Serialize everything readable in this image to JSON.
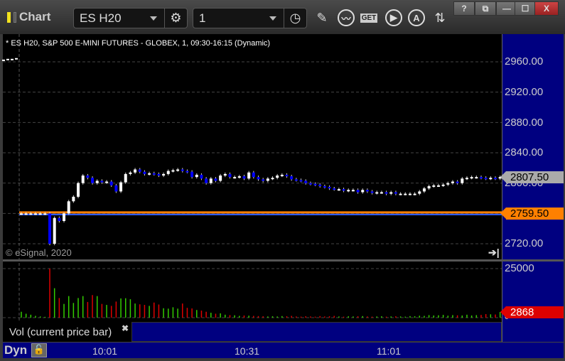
{
  "window": {
    "title": "Chart",
    "help": "?",
    "minimize": "—",
    "maximize": "☐",
    "close": "X"
  },
  "toolbar": {
    "symbol": "ES H20",
    "interval": "1",
    "get_label": "GET",
    "draw_icon": "pencil-icon",
    "study_icon": "study-icon",
    "play_icon": "play-icon",
    "alert_icon": "alert-icon",
    "link_icon": "link-icon"
  },
  "chart": {
    "header": "* ES H20, S&P 500 E-MINI FUTURES - GLOBEX, 1, 09:30-16:15 (Dynamic)",
    "copyright": "© eSignal, 2020",
    "price_labels": [
      "2960.00",
      "2920.00",
      "2880.00",
      "2840.00",
      "2800.00",
      "2720.00"
    ],
    "last_price": "2807.50",
    "line_price": "2759.50",
    "vol_labels": [
      "25000",
      "0"
    ],
    "last_volume": "2868",
    "legend": "Vol (current price bar)",
    "legend_close": "✖",
    "mode": "Dyn",
    "time_labels": [
      "10:01",
      "10:31",
      "11:01"
    ],
    "colors": {
      "up": "#ffffff",
      "down": "#0000ff",
      "vol_up": "#33cc00",
      "vol_down": "#dd0000",
      "orange": "#ff8000",
      "blue": "#3060ff",
      "axis_bg": "#000080"
    }
  },
  "chart_data": {
    "type": "candlestick",
    "ylim": [
      2710,
      2975
    ],
    "vol_ylim": [
      0,
      25000
    ],
    "prev_session_closes": [
      2962,
      2963,
      2963,
      2964
    ],
    "first_open": 2760,
    "closes": [
      2760,
      2760,
      2760,
      2760,
      2760,
      2760,
      2720,
      2754,
      2750,
      2760,
      2776,
      2782,
      2800,
      2810,
      2807,
      2800,
      2803,
      2801,
      2802,
      2797,
      2789,
      2801,
      2812,
      2814,
      2818,
      2815,
      2812,
      2813,
      2812,
      2810,
      2812,
      2816,
      2817,
      2818,
      2816,
      2815,
      2808,
      2811,
      2806,
      2800,
      2806,
      2803,
      2810,
      2812,
      2808,
      2808,
      2809,
      2806,
      2814,
      2808,
      2805,
      2803,
      2806,
      2807,
      2810,
      2811,
      2809,
      2805,
      2804,
      2803,
      2800,
      2799,
      2798,
      2796,
      2795,
      2793,
      2792,
      2792,
      2790,
      2791,
      2791,
      2788,
      2791,
      2789,
      2787,
      2788,
      2788,
      2786,
      2788,
      2786,
      2786,
      2786,
      2786,
      2786,
      2789,
      2793,
      2796,
      2797,
      2797,
      2798,
      2800,
      2802,
      2800,
      2806,
      2807,
      2808,
      2808,
      2807,
      2806,
      2807,
      2806,
      2808
    ],
    "volumes": [
      3000,
      2000,
      1500,
      900,
      600,
      400,
      25000,
      15000,
      10000,
      7000,
      11000,
      7500,
      10000,
      11000,
      8000,
      11500,
      11000,
      7000,
      6500,
      6000,
      8200,
      9800,
      9900,
      9400,
      7200,
      6800,
      6500,
      6000,
      7700,
      6700,
      4800,
      4600,
      5300,
      4600,
      7200,
      5000,
      4700,
      3900,
      3600,
      3000,
      2500,
      2000,
      2200,
      1500,
      1300,
      1200,
      900,
      1100,
      1000,
      900,
      800,
      700,
      600,
      700,
      600,
      800,
      700,
      900,
      600,
      500,
      700,
      600,
      500,
      800,
      600,
      700,
      900,
      600,
      500,
      700,
      600,
      700,
      800,
      600,
      500,
      600,
      700,
      500,
      600,
      700,
      600,
      500,
      800,
      700,
      1000,
      900,
      1300,
      1100,
      1200,
      1400,
      1000,
      1300,
      1200,
      1100,
      1500,
      1100,
      1300,
      1400,
      1800,
      1700,
      1600,
      2868
    ],
    "price_line": 2759.5,
    "last": 2807.5
  }
}
